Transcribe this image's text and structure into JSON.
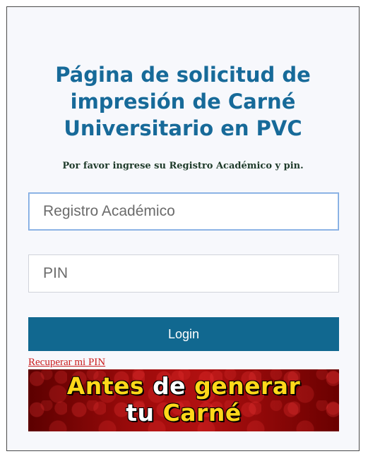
{
  "page": {
    "title": "Página de solicitud de impresión de Carné Universitario en PVC",
    "title_lines": [
      "Página de solicitud de",
      "impresión de Carné",
      "Universitario en PVC"
    ],
    "subtitle": "Por favor ingrese su Registro Académico y pin."
  },
  "form": {
    "registro_placeholder": "Registro Académico",
    "registro_value": "",
    "pin_placeholder": "PIN",
    "pin_value": "",
    "login_label": "Login",
    "recover_link": "Recuperar mi PIN"
  },
  "banner": {
    "line1_part1": "Antes",
    "line1_part2": "de",
    "line1_part3": "generar",
    "line2_part1": "tu",
    "line2_part2": "Carné"
  },
  "colors": {
    "title": "#176a99",
    "button": "#116890",
    "link": "#cc1f1f",
    "banner_yellow": "#ffd81a"
  }
}
